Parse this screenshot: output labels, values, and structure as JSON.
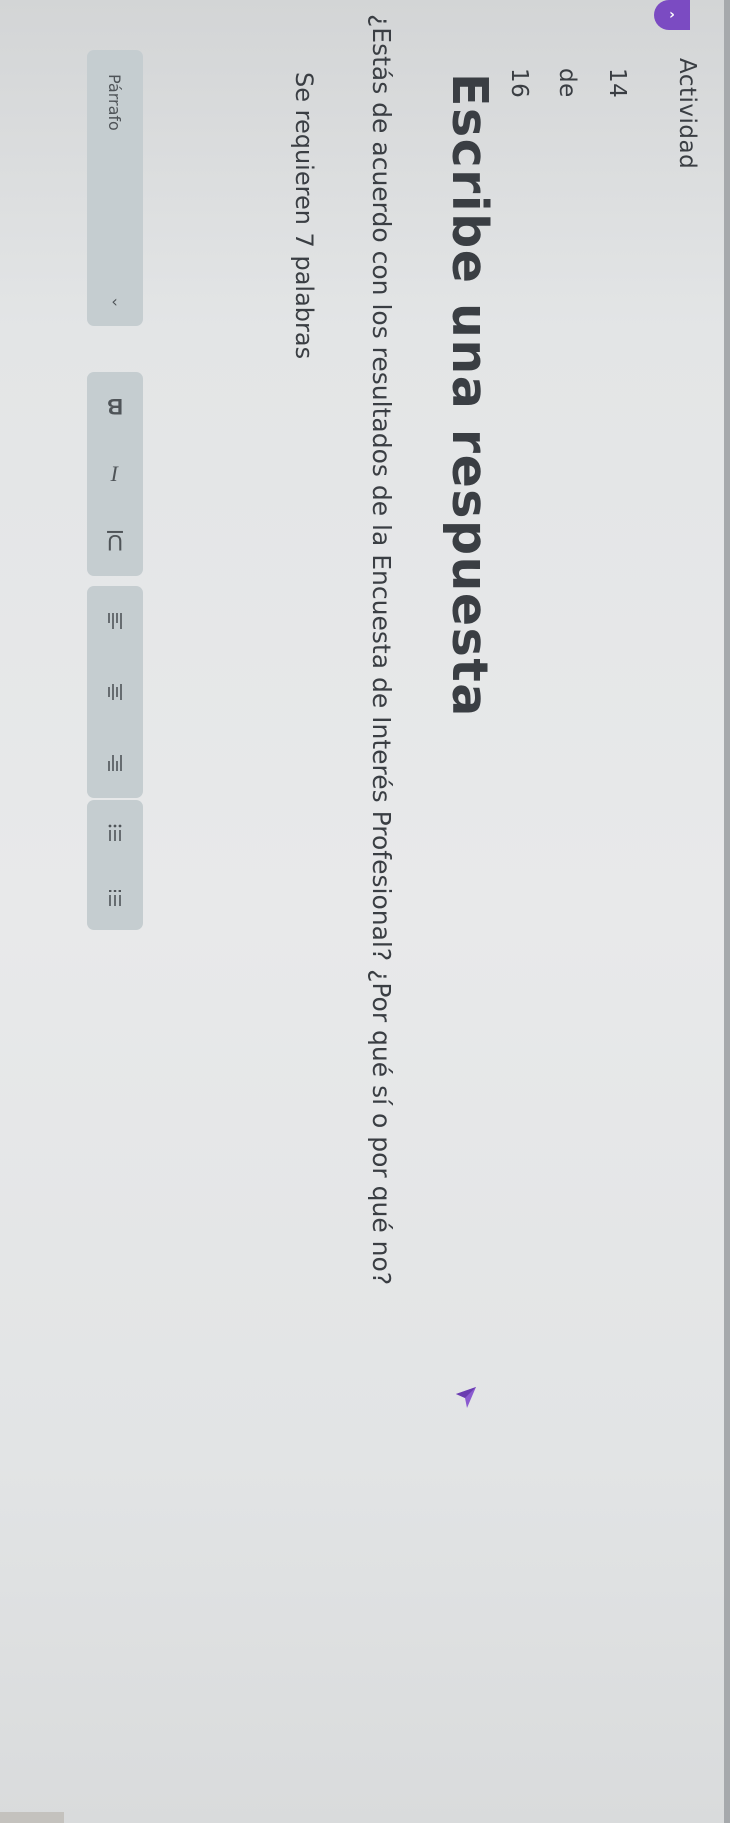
{
  "nav": {
    "activity_label": "Actividad",
    "current": "14",
    "separator": "de",
    "total": "16"
  },
  "main": {
    "title": "Escribe una respuesta",
    "question": "¿Estás de acuerdo con los resultados de la Encuesta de Interés Profesional? ¿Por qué sí o por qué no?",
    "requirement": "Se requieren 7 palabras"
  },
  "toolbar": {
    "paragraph_label": "Párrafo",
    "bold_label": "B",
    "italic_label": "I",
    "underline_label": "U"
  },
  "icons": {
    "sidebar_toggle": "chevron-right-icon",
    "paragraph_dropdown": "chevron-down-icon",
    "align_left": "align-left-icon",
    "align_center": "align-center-icon",
    "align_right": "align-right-icon",
    "bulleted_list": "bulleted-list-icon",
    "numbered_list": "numbered-list-icon",
    "cursor": "pen-cursor-icon"
  },
  "colors": {
    "accent": "#7b4bc2",
    "toolbar_bg": "#c5cdd0",
    "text": "#3a3e43"
  }
}
